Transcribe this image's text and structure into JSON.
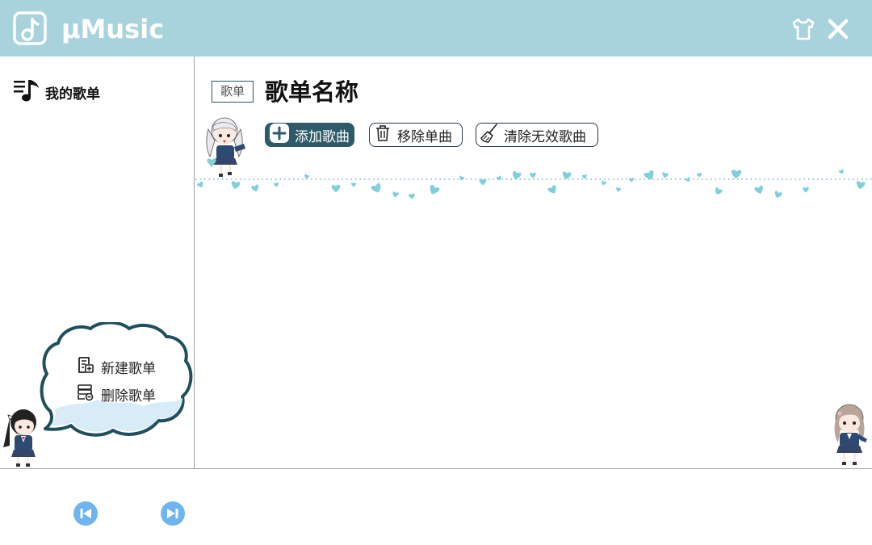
{
  "app": {
    "name": "μMusic"
  },
  "titlebar": {
    "theme_icon": "tshirt-icon",
    "close_icon": "close-icon",
    "background": "#a8d3dc"
  },
  "sidebar": {
    "my_playlists_label": "我的歌单",
    "menu": {
      "new_playlist_label": "新建歌单",
      "delete_playlist_label": "删除歌单"
    }
  },
  "main": {
    "tag_label": "歌单",
    "playlist_title": "歌单名称",
    "buttons": {
      "add_songs": "添加歌曲",
      "remove_song": "移除单曲",
      "clear_invalid": "清除无效歌曲"
    }
  },
  "player": {
    "prev_icon": "skip-previous-icon",
    "next_icon": "skip-next-icon",
    "accent": "#6eb4ee"
  },
  "colors": {
    "accent_dark": "#2c5a68",
    "heart": "#7fcfdc"
  }
}
